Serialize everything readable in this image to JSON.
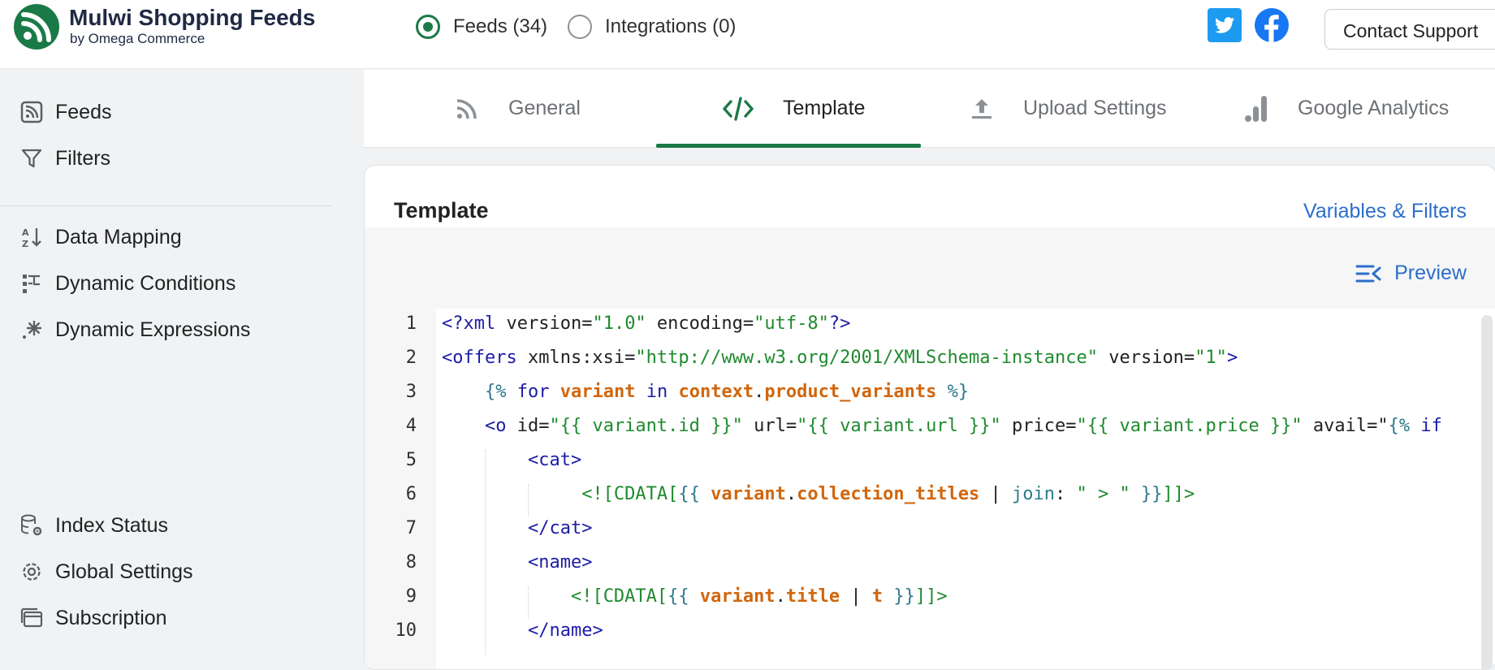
{
  "brand": {
    "name": "Mulwi Shopping Feeds",
    "subtitle": "by Omega Commerce"
  },
  "mode": [
    {
      "label": "Feeds (34)",
      "selected": true
    },
    {
      "label": "Integrations (0)",
      "selected": false
    }
  ],
  "social": {
    "twitter": "twitter-icon",
    "facebook": "facebook-icon"
  },
  "support": {
    "label": "Contact Support"
  },
  "sidebar": {
    "top": [
      {
        "label": "Feeds",
        "icon": "rss-icon"
      },
      {
        "label": "Filters",
        "icon": "filter-icon"
      }
    ],
    "middle": [
      {
        "label": "Data Mapping",
        "icon": "sort-az-icon"
      },
      {
        "label": "Dynamic Conditions",
        "icon": "branch-icon"
      },
      {
        "label": "Dynamic Expressions",
        "icon": "sparkle-icon"
      }
    ],
    "bottom": [
      {
        "label": "Index Status",
        "icon": "database-gear-icon"
      },
      {
        "label": "Global Settings",
        "icon": "gear-icon"
      },
      {
        "label": "Subscription",
        "icon": "card-stack-icon"
      }
    ]
  },
  "tabs": [
    {
      "label": "General",
      "icon": "rss-icon",
      "active": false
    },
    {
      "label": "Template",
      "icon": "code-icon",
      "active": true
    },
    {
      "label": "Upload Settings",
      "icon": "upload-icon",
      "active": false
    },
    {
      "label": "Google Analytics",
      "icon": "analytics-icon",
      "active": false
    }
  ],
  "card": {
    "title": "Template",
    "variables_link": "Variables & Filters",
    "preview_label": "Preview"
  },
  "editor": {
    "line_numbers": [
      "1",
      "2",
      "3",
      "4",
      "5",
      "6",
      "7",
      "8",
      "9",
      "10"
    ],
    "lines": [
      "<?xml version=\"1.0\" encoding=\"utf-8\"?>",
      "<offers xmlns:xsi=\"http://www.w3.org/2001/XMLSchema-instance\" version=\"1\">",
      "    {% for variant in context.product_variants %}",
      "    <o id=\"{{ variant.id }}\" url=\"{{ variant.url }}\" price=\"{{ variant.price }}\" avail=\"{% if",
      "        <cat>",
      "             <![CDATA[{{ variant.collection_titles | join: \" > \" }}]]>",
      "        </cat>",
      "        <name>",
      "            <![CDATA[{{ variant.title | t }}]]>",
      "        </name>"
    ]
  },
  "colors": {
    "accent": "#1a7a47",
    "link": "#2c6ecb",
    "twitter": "#1d9bf0",
    "facebook": "#1877f2"
  }
}
